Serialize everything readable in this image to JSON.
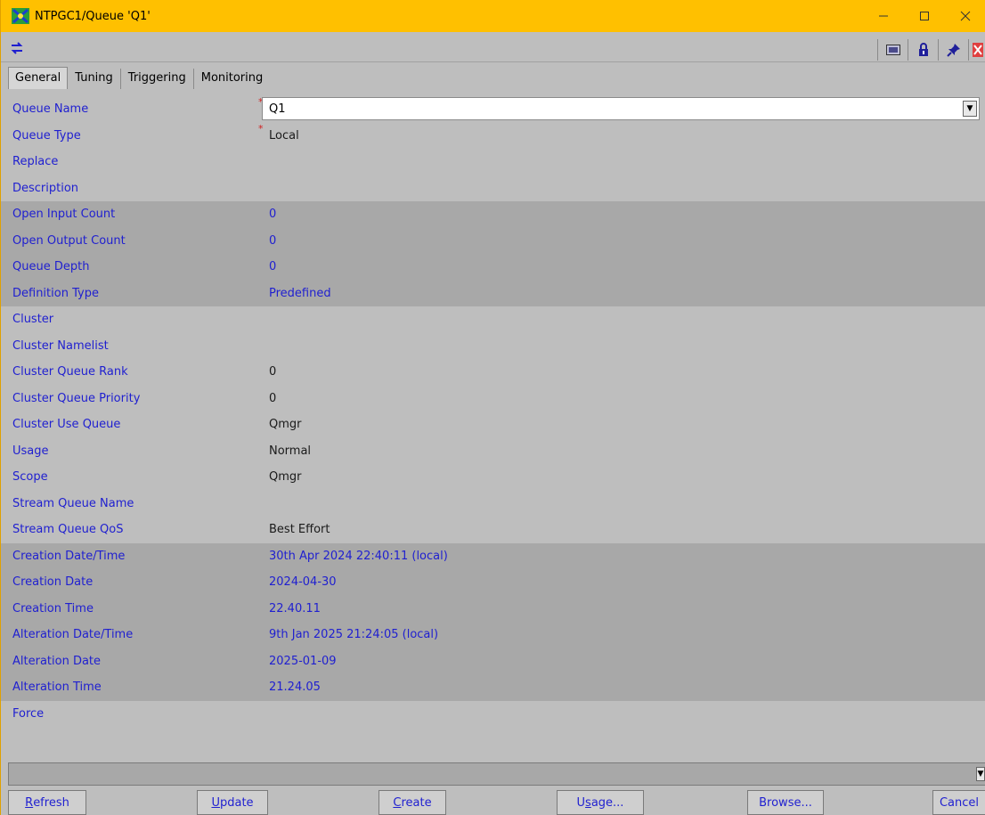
{
  "window": {
    "title": "NTPGC1/Queue 'Q1'"
  },
  "tabs": [
    {
      "label": "General"
    },
    {
      "label": "Tuning"
    },
    {
      "label": "Triggering"
    },
    {
      "label": "Monitoring"
    }
  ],
  "form": {
    "queue_name": {
      "label": "Queue Name",
      "value": "Q1"
    },
    "queue_type": {
      "label": "Queue Type",
      "value": "Local"
    },
    "replace": {
      "label": "Replace"
    },
    "description": {
      "label": "Description"
    },
    "open_input_count": {
      "label": "Open Input Count",
      "value": "0"
    },
    "open_output_count": {
      "label": "Open Output Count",
      "value": "0"
    },
    "queue_depth": {
      "label": "Queue Depth",
      "value": "0"
    },
    "definition_type": {
      "label": "Definition Type",
      "value": "Predefined"
    },
    "cluster": {
      "label": "Cluster"
    },
    "cluster_namelist": {
      "label": "Cluster Namelist"
    },
    "cluster_queue_rank": {
      "label": "Cluster Queue Rank",
      "value": "0"
    },
    "cluster_queue_priority": {
      "label": "Cluster Queue Priority",
      "value": "0"
    },
    "cluster_use_queue": {
      "label": "Cluster Use Queue",
      "value": "Qmgr"
    },
    "usage": {
      "label": "Usage",
      "value": "Normal"
    },
    "scope": {
      "label": "Scope",
      "value": "Qmgr"
    },
    "stream_queue_name": {
      "label": "Stream Queue Name"
    },
    "stream_queue_qos": {
      "label": "Stream Queue QoS",
      "value": "Best Effort"
    },
    "creation_datetime": {
      "label": "Creation Date/Time",
      "value": "30th Apr 2024 22:40:11 (local)"
    },
    "creation_date": {
      "label": "Creation Date",
      "value": "2024-04-30"
    },
    "creation_time": {
      "label": "Creation Time",
      "value": "22.40.11"
    },
    "alteration_datetime": {
      "label": "Alteration Date/Time",
      "value": "9th Jan 2025 21:24:05 (local)"
    },
    "alteration_date": {
      "label": "Alteration Date",
      "value": "2025-01-09"
    },
    "alteration_time": {
      "label": "Alteration Time",
      "value": "21.24.05"
    },
    "force": {
      "label": "Force"
    }
  },
  "buttons": {
    "refresh_pre": "",
    "refresh_u": "R",
    "refresh_post": "efresh",
    "update_pre": "",
    "update_u": "U",
    "update_post": "pdate",
    "create_pre": "",
    "create_u": "C",
    "create_post": "reate",
    "usage_pre": "U",
    "usage_u": "s",
    "usage_post": "age...",
    "browse": "Browse...",
    "cancel": "Cancel"
  },
  "colors": {
    "titlebar": "#ffc000",
    "label": "#1f1fd0",
    "background": "#bebebe",
    "shaded_row": "#a8a8a8",
    "required_marker": "#d02020"
  }
}
